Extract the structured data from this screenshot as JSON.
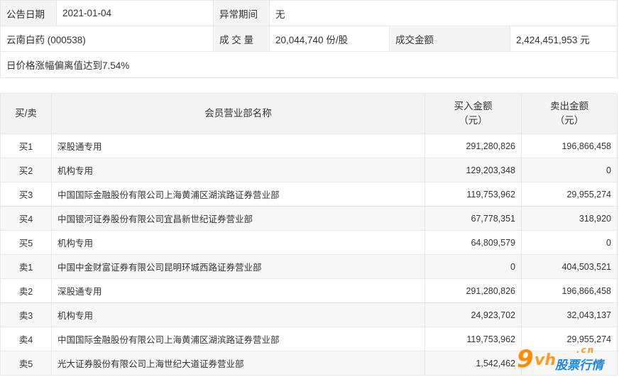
{
  "info": {
    "announce_label": "公告日期",
    "announce_value": "2021-01-04",
    "period_label": "异常期间",
    "period_value": "无",
    "stock_name": "云南白药 (000538)",
    "volume_label": "成 交 量",
    "volume_value": "20,044,740 份/股",
    "turnover_label": "成交金额",
    "turnover_value": "2,424,451,953 元",
    "reason": "日价格涨幅偏离值达到7.54%"
  },
  "table": {
    "headers": {
      "side": "买/卖",
      "branch": "会员营业部名称",
      "buy": "买入金额",
      "sell": "卖出金额",
      "unit": "（元）"
    },
    "rows": [
      {
        "side": "买1",
        "branch": "深股通专用",
        "buy": "291,280,826",
        "sell": "196,866,458"
      },
      {
        "side": "买2",
        "branch": "机构专用",
        "buy": "129,203,348",
        "sell": "0"
      },
      {
        "side": "买3",
        "branch": "中国国际金融股份有限公司上海黄浦区湖滨路证券营业部",
        "buy": "119,753,962",
        "sell": "29,955,274"
      },
      {
        "side": "买4",
        "branch": "中国银河证券股份有限公司宜昌新世纪证券营业部",
        "buy": "67,778,351",
        "sell": "318,920"
      },
      {
        "side": "买5",
        "branch": "机构专用",
        "buy": "64,809,579",
        "sell": "0"
      },
      {
        "side": "卖1",
        "branch": "中国中金财富证券有限公司昆明环城西路证券营业部",
        "buy": "0",
        "sell": "404,503,521"
      },
      {
        "side": "卖2",
        "branch": "深股通专用",
        "buy": "291,280,826",
        "sell": "196,866,458"
      },
      {
        "side": "卖3",
        "branch": "机构专用",
        "buy": "24,923,702",
        "sell": "32,043,137"
      },
      {
        "side": "卖4",
        "branch": "中国国际金融股份有限公司上海黄浦区湖滨路证券营业部",
        "buy": "119,753,962",
        "sell": "29,955,274"
      },
      {
        "side": "卖5",
        "branch": "光大证券股份有限公司上海世纪大道证券营业部",
        "buy": "1,542,462",
        "sell": ""
      }
    ]
  },
  "watermark": {
    "nine": "9",
    "vh": "vh",
    "cn": ".cn",
    "brand": "股票行情"
  }
}
